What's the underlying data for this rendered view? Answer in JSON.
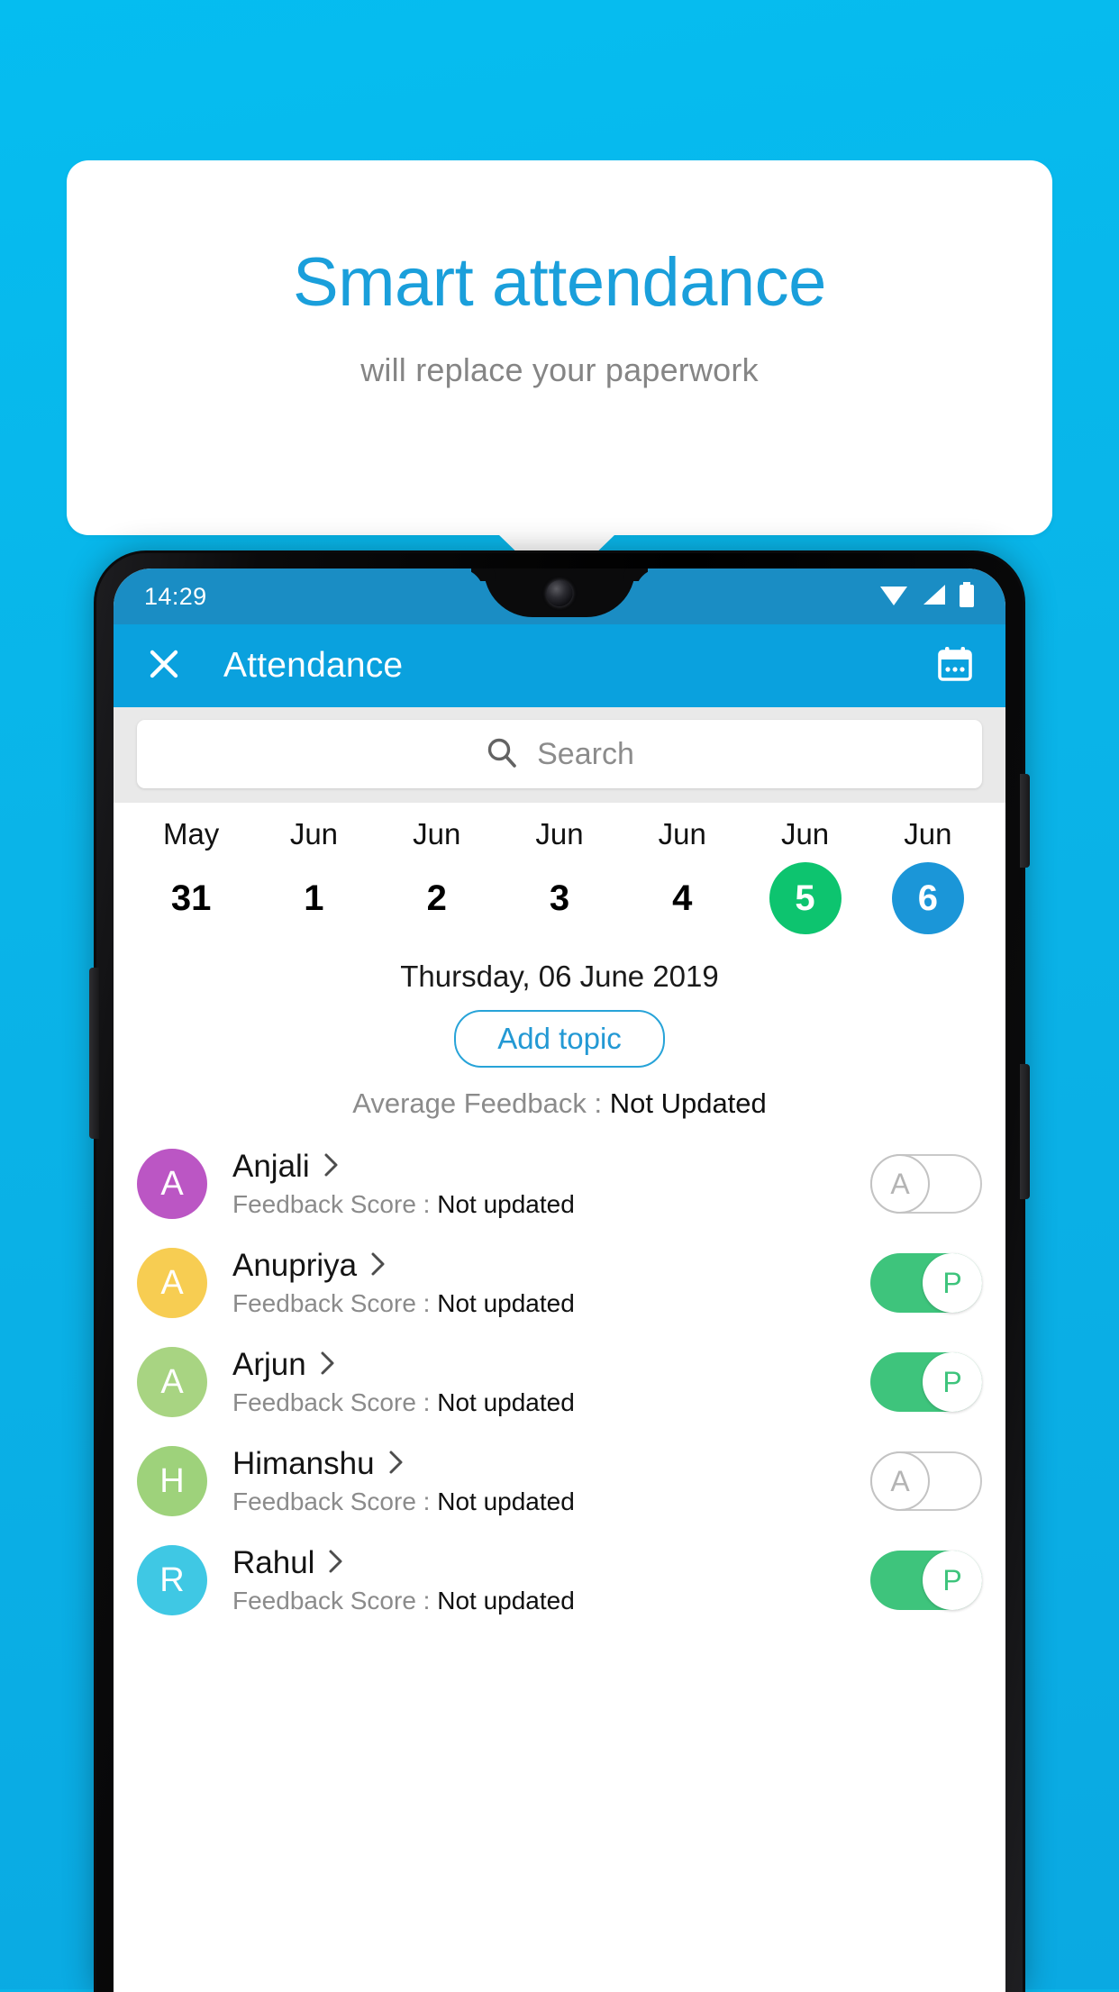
{
  "promo": {
    "headline": "Smart attendance",
    "subheadline": "will replace your paperwork"
  },
  "colors": {
    "background": "#0ab4e8",
    "headline": "#1a9fdb",
    "appbar": "#0aa1de",
    "statusbar": "#1a8dc4",
    "accent_green": "#0dc46f",
    "accent_blue": "#1b96d8",
    "toggle_on": "#3ec47c"
  },
  "phone": {
    "status_bar": {
      "time": "14:29",
      "icons": [
        "wifi-icon",
        "signal-icon",
        "battery-icon"
      ]
    },
    "app_bar": {
      "close_label": "✕",
      "title": "Attendance",
      "calendar_icon": "calendar-icon"
    },
    "search": {
      "placeholder": "Search",
      "value": "",
      "icon": "search-icon"
    },
    "date_strip": [
      {
        "month": "May",
        "day": "31",
        "state": "normal"
      },
      {
        "month": "Jun",
        "day": "1",
        "state": "normal"
      },
      {
        "month": "Jun",
        "day": "2",
        "state": "normal"
      },
      {
        "month": "Jun",
        "day": "3",
        "state": "normal"
      },
      {
        "month": "Jun",
        "day": "4",
        "state": "normal"
      },
      {
        "month": "Jun",
        "day": "5",
        "state": "green"
      },
      {
        "month": "Jun",
        "day": "6",
        "state": "blue"
      }
    ],
    "selected_date_label": "Thursday, 06 June 2019",
    "add_topic_label": "Add topic",
    "average_feedback": {
      "label": "Average Feedback : ",
      "value": "Not Updated"
    },
    "score_label": "Feedback Score : ",
    "students": [
      {
        "name": "Anjali",
        "initial": "A",
        "avatar_color": "#bb56c4",
        "score": "Not updated",
        "attendance": "A",
        "present": false
      },
      {
        "name": "Anupriya",
        "initial": "A",
        "avatar_color": "#f7cd52",
        "score": "Not updated",
        "attendance": "P",
        "present": true
      },
      {
        "name": "Arjun",
        "initial": "A",
        "avatar_color": "#a8d482",
        "score": "Not updated",
        "attendance": "P",
        "present": true
      },
      {
        "name": "Himanshu",
        "initial": "H",
        "avatar_color": "#9ed27b",
        "score": "Not updated",
        "attendance": "A",
        "present": false
      },
      {
        "name": "Rahul",
        "initial": "R",
        "avatar_color": "#3fc8e4",
        "score": "Not updated",
        "attendance": "P",
        "present": true
      }
    ]
  }
}
